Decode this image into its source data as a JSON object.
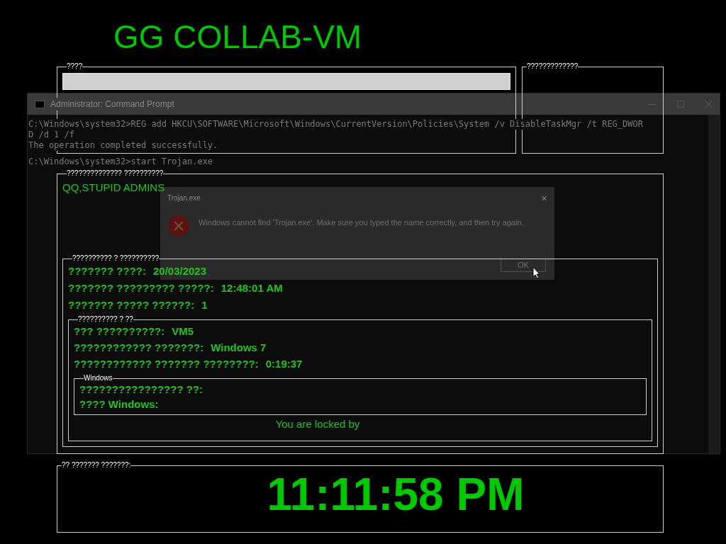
{
  "cmd": {
    "title": "Administrator: Command Prompt",
    "lines": [
      "C:\\Windows\\system32>REG add HKCU\\SOFTWARE\\Microsoft\\Windows\\CurrentVersion\\Policies\\System /v DisableTaskMgr /t REG_DWOR",
      "D /d 1 /f",
      "The operation completed successfully.",
      "C:\\Windows\\system32>start Trojan.exe"
    ]
  },
  "dialog": {
    "title": "Trojan.exe",
    "close": "✕",
    "message": "Windows cannot find 'Trojan.exe'. Make sure you typed the name correctly, and then try again.",
    "button": "OK"
  },
  "title": "GG COLLAB-VM",
  "top_group": {
    "legend": "????"
  },
  "side_group": {
    "legend": "?????????????"
  },
  "message_group": {
    "legend": "?????????????? ??????????",
    "message": "QQ,STUPID ADMINS",
    "info_group": {
      "legend": "?????????? ? ??????????",
      "rows": [
        {
          "label": "??????? ????:",
          "value": "20/03/2023"
        },
        {
          "label": "??????? ????????? ?????:",
          "value": "12:48:01 AM"
        },
        {
          "label": "??????? ????? ??????:",
          "value": "1"
        }
      ],
      "vm_group": {
        "legend": "?????????? ? ??",
        "rows": [
          {
            "label": "??? ??????????:",
            "value": "VM5"
          },
          {
            "label": "???????????? ???????:",
            "value": "Windows 7"
          },
          {
            "label": "???????????? ??????? ????????:",
            "value": "0:19:37"
          }
        ],
        "windows_group": {
          "legend": "Windows",
          "rows": [
            {
              "label": "???????????????? ??:"
            },
            {
              "label": "???? Windows:"
            }
          ]
        }
      },
      "locked_text": "You are locked by"
    }
  },
  "clock_group": {
    "legend": "?? ??????? ???????:",
    "time": "11:11:58 PM"
  }
}
